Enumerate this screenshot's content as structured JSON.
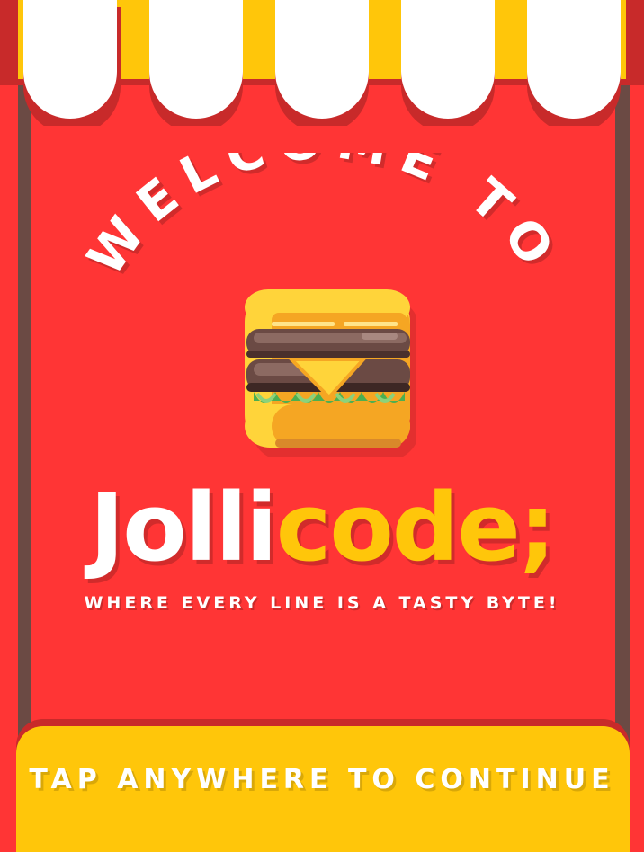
{
  "welcome": {
    "text": "WELCOME TO"
  },
  "brand": {
    "part_white": "Jolli",
    "part_yellow": "code;"
  },
  "tagline": "WHERE EVERY LINE IS A TASTY BYTE!",
  "footer": {
    "label": "TAP ANYWHERE TO CONTINUE"
  },
  "colors": {
    "background": "#ff3535",
    "accent": "#ffc60a",
    "frame": "#6b4a44"
  },
  "icons": {
    "logo": "burger-icon"
  }
}
